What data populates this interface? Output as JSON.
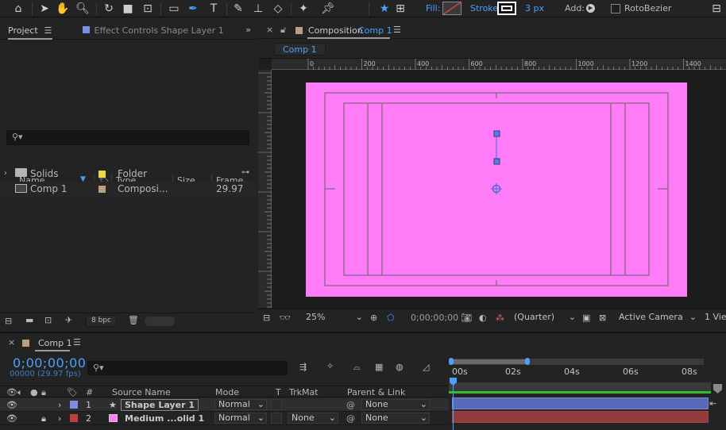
{
  "toolbar": {
    "fill_label": "Fill:",
    "stroke_label": "Stroke:",
    "stroke_width": "3 px",
    "add_label": "Add:",
    "rotobezier_label": "RotoBezier",
    "colors": {
      "accent": "#4aa0ff",
      "fill_swatch": "#c04040"
    }
  },
  "project_panel": {
    "tab_project": "Project",
    "tab_effects": "Effect Controls",
    "tab_effects_layer": "Shape Layer 1",
    "columns": {
      "name": "Name",
      "type": "Type",
      "size": "Size",
      "frame": "Frame..."
    },
    "items": [
      {
        "name": "Solids",
        "type": "Folder",
        "frame": "",
        "swatch": "#e8d84a"
      },
      {
        "name": "Comp 1",
        "type": "Composi...",
        "frame": "29.97",
        "swatch": "#b9a080"
      }
    ],
    "bpc": "8 bpc"
  },
  "comp_panel": {
    "title": "Composition",
    "comp_name": "Comp 1",
    "subtab": "Comp 1",
    "ruler_ticks": [
      "0",
      "200",
      "400",
      "600",
      "800",
      "1000",
      "1200",
      "1400"
    ],
    "zoom": "25%",
    "timecode": "0;00;00;00",
    "resolution": "(Quarter)",
    "camera": "Active Camera",
    "views": "1 Vie",
    "bg_color": "#ff7cf8"
  },
  "timeline": {
    "tab": "Comp 1",
    "timecode": "0;00;00;00",
    "fps": "00000 (29.97 fps)",
    "columns": {
      "source": "Source Name",
      "mode": "Mode",
      "t": "T",
      "trkmat": "TrkMat",
      "parent": "Parent & Link"
    },
    "layers": [
      {
        "num": "1",
        "name": "Shape Layer 1",
        "mode": "Normal",
        "trkmat": "",
        "parent": "None",
        "label": "#7a8ee8"
      },
      {
        "num": "2",
        "name": "Medium ...olid 1",
        "mode": "Normal",
        "trkmat": "None",
        "parent": "None",
        "label": "#ff7cf8"
      }
    ],
    "ticks": [
      "00s",
      "02s",
      "04s",
      "06s",
      "08s"
    ]
  }
}
